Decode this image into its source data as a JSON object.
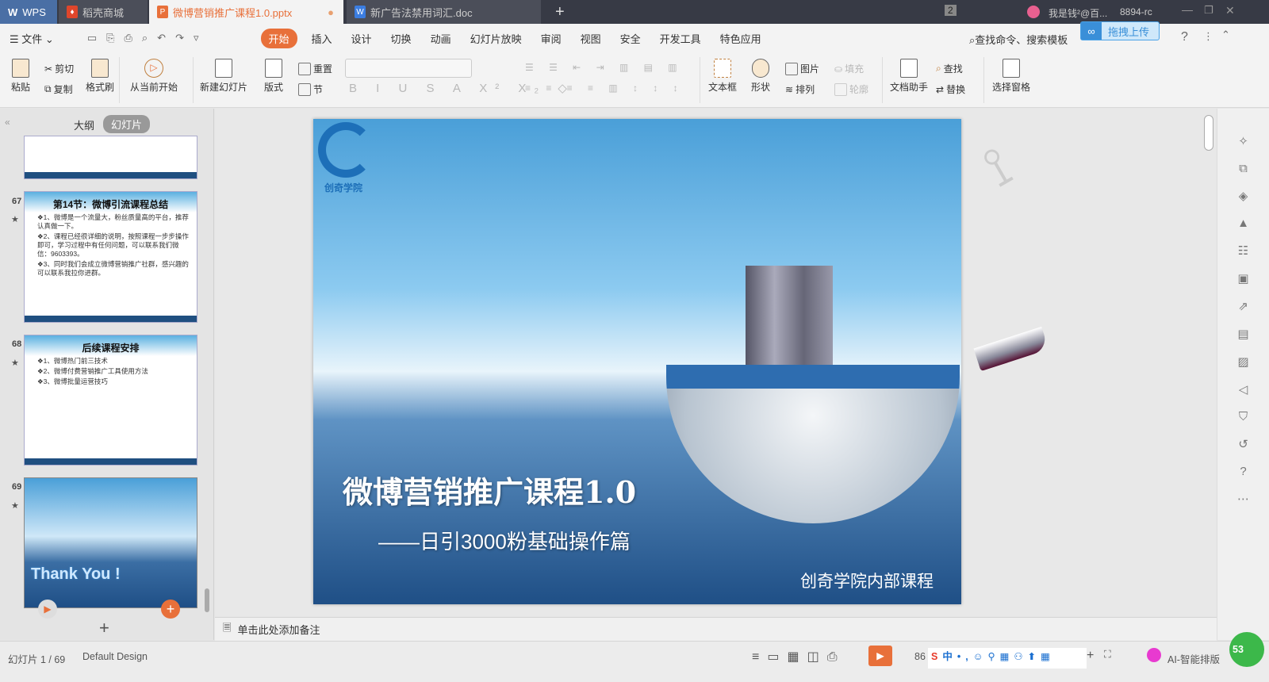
{
  "titlebar": {
    "app": "WPS",
    "tabs": [
      {
        "label": "稻壳商城"
      },
      {
        "label": "微博营销推广课程1.0.pptx"
      },
      {
        "label": "新广告法禁用词汇.doc"
      }
    ],
    "new_tab": "+",
    "badge": "2",
    "user": "我是钱²@百...",
    "code": "8894-rc"
  },
  "menubar": {
    "file": "文件",
    "items": [
      "开始",
      "插入",
      "设计",
      "切换",
      "动画",
      "幻灯片放映",
      "审阅",
      "视图",
      "安全",
      "开发工具",
      "特色应用"
    ],
    "search": "查找命令、搜索模板",
    "upload": "拖拽上传",
    "help": "?"
  },
  "ribbon": {
    "paste": "粘贴",
    "cut": "剪切",
    "copy": "复制",
    "format_painter": "格式刷",
    "from_current": "从当前开始",
    "new_slide": "新建幻灯片",
    "layout": "版式",
    "reset": "重置",
    "section": "节",
    "textbox": "文本框",
    "shape": "形状",
    "picture": "图片",
    "fill": "填充",
    "arrange": "排列",
    "outline": "轮廓",
    "doc_assistant": "文档助手",
    "find": "查找",
    "replace": "替换",
    "selection_pane": "选择窗格"
  },
  "panel": {
    "tabs": [
      "大纲",
      "幻灯片"
    ],
    "slides": [
      {
        "number": "67",
        "title": "第14节：微博引流课程总结",
        "lines": [
          "❖1、微博是一个流量大，粉丝质量高的平台，推荐认真做一下。",
          "❖2、课程已经很详细的说明，按照课程一步步操作即可，学习过程中有任何问题，可以联系我们微信：9603393。",
          "❖3、同时我们会成立微博营销推广社群，感兴趣的可以联系我拉你进群。"
        ]
      },
      {
        "number": "68",
        "title": "后续课程安排",
        "lines": [
          "❖1、微博热门前三技术",
          "❖2、微博付费营销推广工具使用方法",
          "❖3、微博批量运营技巧"
        ]
      },
      {
        "number": "69",
        "title": "Thank You !",
        "lines": []
      }
    ]
  },
  "slide": {
    "logo_text": "创奇学院",
    "title": "微博营销推广课程1.0",
    "subtitle": "——日引3000粉基础操作篇",
    "footer": "创奇学院内部课程"
  },
  "notes": {
    "placeholder": "单击此处添加备注"
  },
  "status": {
    "slide_count": "幻灯片 1 / 69",
    "theme": "Default Design",
    "zoom": "86",
    "ai": "AI-智能排版",
    "badge": "53"
  }
}
